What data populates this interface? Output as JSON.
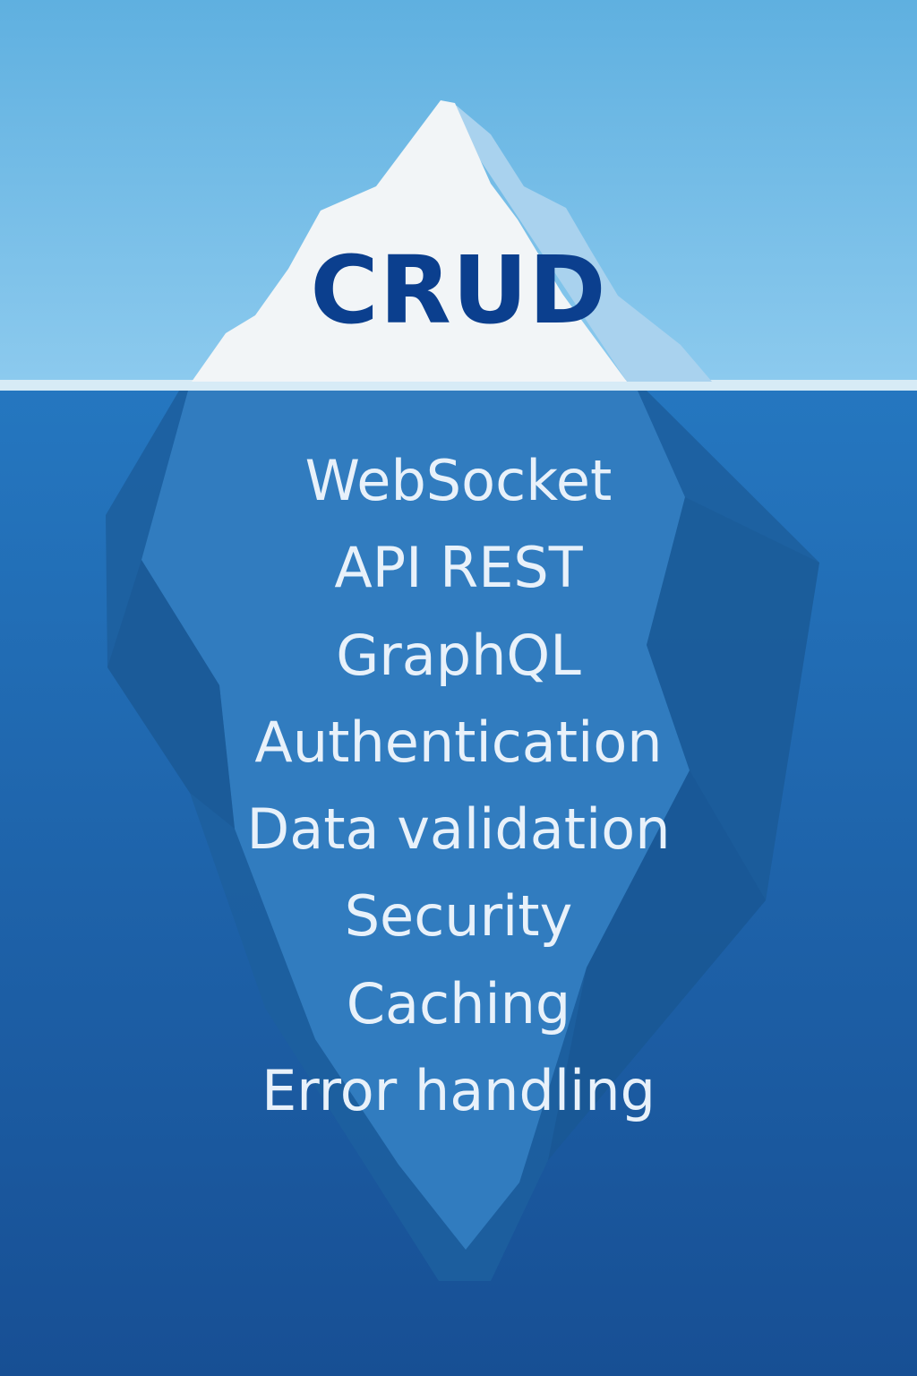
{
  "diagram": {
    "tip_label": "CRUD",
    "hidden_items": [
      "WebSocket",
      "API REST",
      "GraphQL",
      "Authentication",
      "Data validation",
      "Security",
      "Caching",
      "Error handling"
    ]
  },
  "colors": {
    "sky_top": "#5fb0e0",
    "sky_bottom": "#8ccaee",
    "water_top": "#2577c0",
    "water_bottom": "#174f94",
    "ice_tip": "#f2f5f7",
    "ice_tip_shade": "#a9d2ee",
    "waterline": "#d7ebf6",
    "iceberg_body": "#2d78bd",
    "iceberg_shadow": "#1d5f9f",
    "tip_text": "#0b3f8e",
    "list_text": "#e8f1fa"
  }
}
